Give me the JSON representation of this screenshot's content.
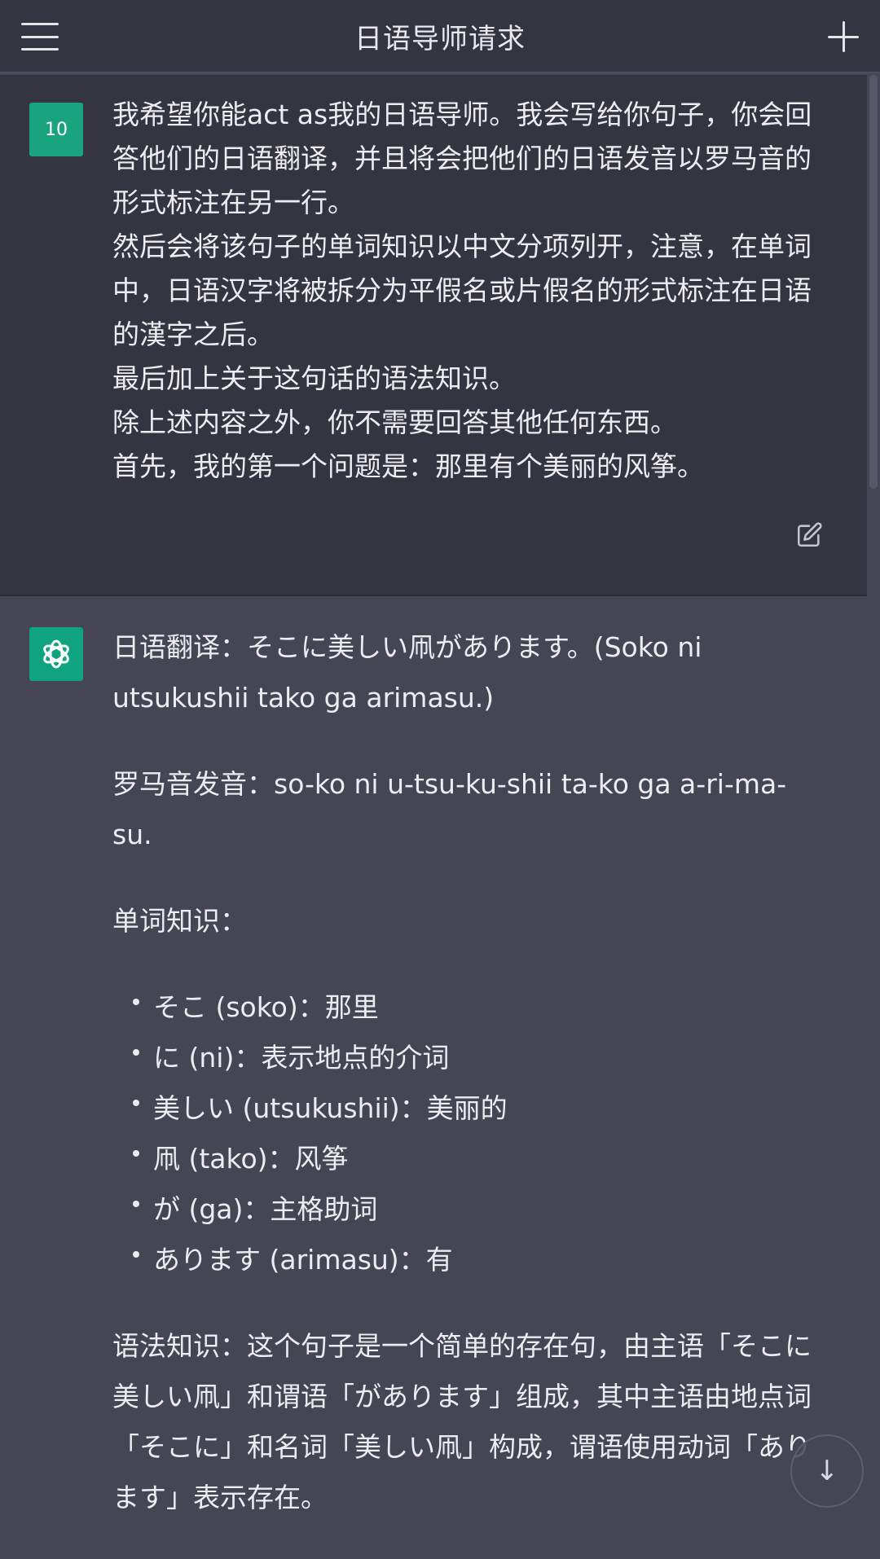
{
  "header": {
    "title": "日语导师请求",
    "menu_icon": "hamburger-menu-icon",
    "new_chat_icon": "plus-icon"
  },
  "user_message": {
    "avatar_text": "10",
    "lines": [
      "我希望你能act as我的日语导师。我会写给你句子，你会回答他们的日语翻译，并且将会把他们的日语发音以罗马音的形式标注在另一行。",
      "然后会将该句子的单词知识以中文分项列开，注意，在单词中，日语汉字将被拆分为平假名或片假名的形式标注在日语的漢字之后。",
      "最后加上关于这句话的语法知识。",
      "除上述内容之外，你不需要回答其他任何东西。",
      "首先，我的第一个问题是：那里有个美丽的风筝。"
    ],
    "edit_icon": "edit-icon"
  },
  "assistant_message": {
    "avatar_icon": "openai-logo-icon",
    "translation": "日语翻译：そこに美しい凧があります。(Soko ni utsukushii tako ga arimasu.)",
    "pronunciation": "罗马音发音：so-ko ni u-tsu-ku-shii ta-ko ga a-ri-ma-su.",
    "vocab_heading": "单词知识：",
    "vocab": [
      "そこ (soko)：那里",
      "に (ni)：表示地点的介词",
      "美しい (utsukushii)：美丽的",
      "凧 (tako)：风筝",
      "が (ga)：主格助词",
      "あります (arimasu)：有"
    ],
    "grammar": "语法知识：这个句子是一个简单的存在句，由主语「そこに美しい凧」和谓语「があります」组成，其中主语由地点词「そこに」和名词「美しい凧」构成，谓语使用动词「あります」表示存在。"
  },
  "scroll_down_icon": "arrow-down-icon",
  "colors": {
    "header_bg": "#343541",
    "user_bg": "#343541",
    "assistant_bg": "#444654",
    "avatar_green": "#19a37f",
    "text": "#ececf1"
  }
}
